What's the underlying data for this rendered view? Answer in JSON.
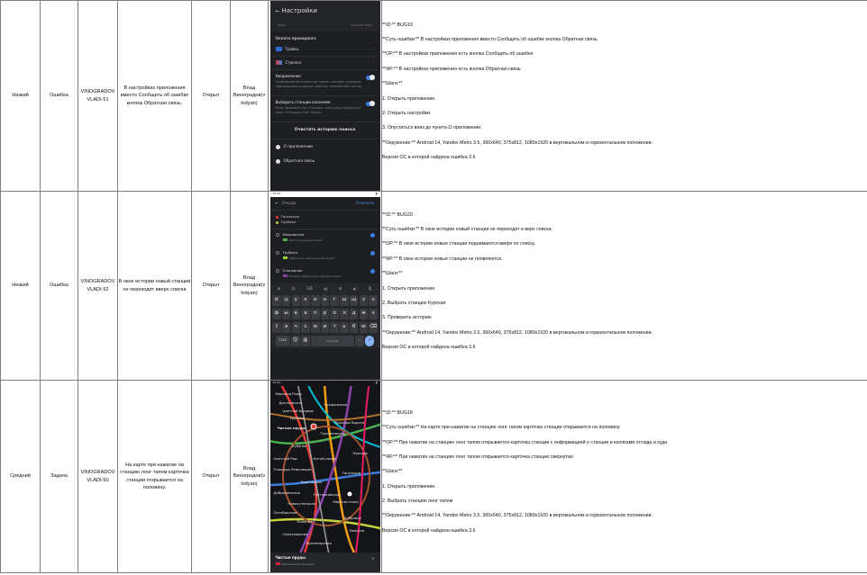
{
  "bugs": [
    {
      "priority": "Низкий",
      "type": "Ошибка",
      "key_line1": "VINOGRADOV",
      "key_line2": "VLADI-51",
      "summary": "В настройках приложения вместо Сообщить об ошибке кнопка Обратная связь.",
      "status": "Открыт",
      "assignee": "Влад Виноградов(v lodyan)",
      "description": [
        "**ID:** BUG19",
        "**Суть ошибки:** В настройках приложения вместо Сообщить об ошибке кнопка Обратная связь.",
        "**ОР:** В настройках приложения есть кнопка Сообщить об ошибке",
        "**ФР:** В настройках приложения есть кнопка Обратная связь",
        "**Шаги:**",
        "1. Открыть приложение.",
        "2. Открыть настройки",
        "3. Опуститься вниз до пункта О приложении",
        "**Окружение:** Android 14, Yandex Metro 3.6, 360x640, 375x812, 1080x1920 в вертикальном и горизонтальном положении.",
        "Версия ОС в которой найдена ошибка 3.6"
      ]
    },
    {
      "priority": "Низкий",
      "type": "Ошибка",
      "key_line1": "VINOGRADOV",
      "key_line2": "VLADI-52",
      "summary": "В окне истории новый станции не переходят вверх списка",
      "status": "Открыт",
      "assignee": "Влад Виноградов(v lodyan)",
      "description": [
        "**ID:** BUG20",
        "**Суть ошибки:** В окне истории новый станции не переходят в верх списка.",
        "**ОР:** В окне истории новые станции поднимаются вверх по списку.",
        "**ФР:** В окне истории новые станции не появляются.",
        "**Шаги:**",
        "1. Открыть приложение.",
        "2. Выбрать станцию Курская",
        "3. Проверить историю",
        "**Окружение:** Android 14, Yandex Metro 3.6, 360x640, 375x812, 1080x1920 в вертикальном и горизонтальном положении.",
        "Версия ОС в которой найдена ошибка 3.6"
      ]
    },
    {
      "priority": "Средний",
      "type": "Задача",
      "key_line1": "VINOGRADOV",
      "key_line2": "VLADI-50",
      "summary": "На карте при нажатие на станцию лонг тапом карточка станции открывается на половину.",
      "status": "Открыт",
      "assignee": "Влад Виноградов(v lodyan)",
      "description": [
        "**ID:** BUG18",
        "**Суть ошибки:** На карте при нажатие на станцию лонг тапом карточка станции открывается на половину.",
        "**ОР:** При нажатие на станцию лонг тапом открывается карточка станции с информацией о станции и кнопками отсюда и куда",
        "**ФР:** При нажатие на станцию лонг тапом открывается карточка станции свернутая",
        "**Шаги:**",
        "1. Открыть приложение.",
        "2. Выбрать станцию лонг тапом",
        "**Окружение:** Android 14, Yandex Metro 3.6, 360x640, 375x812, 1080x1920 в вертикальном и горизонтальном положении.",
        "Версия ОС в которой найдена ошибка 3.6"
      ]
    }
  ],
  "shot_settings": {
    "title": "Настройки",
    "header_left": "Язык",
    "header_right": "Русский язык",
    "pay_section": "Оплата проездного",
    "pay_items": [
      "Тройка",
      "Стрелка"
    ],
    "notif_title": "Уведомления",
    "notif_body": "Сообщения об открытии новых станций, крупных перекрытиях и других важных изменениях метро",
    "station_title": "Выбирать станции касанием",
    "station_body": "Если нажимать на станцию, она сразу появится в поле «Откуда» или «Куда»",
    "clear_btn": "Очистить историю поиска",
    "about": "О приложении",
    "feedback": "Обратная связь"
  },
  "shot_search": {
    "time": "15:03",
    "placeholder": "Откуда",
    "cancel": "Отменить",
    "history": [
      "Таганская",
      "Трубная"
    ],
    "stations": [
      {
        "name": "Маяковская",
        "line": "Замоскворецкая линия",
        "color": "#4caf50"
      },
      {
        "name": "Трубная",
        "line": "Люблинско-Дмитровская линия",
        "color": "#9acd32"
      },
      {
        "name": "Планерная",
        "line": "Таганско-Краснопресненская линия",
        "color": "#8e44ad"
      }
    ],
    "kb_tools": [
      "⊞",
      "☺",
      "GIF",
      "▤",
      "⚙",
      "◐",
      "🎙"
    ],
    "kb_row1": [
      "й",
      "ц",
      "у",
      "к",
      "е",
      "н",
      "г",
      "ш",
      "щ",
      "з",
      "х"
    ],
    "kb_row2": [
      "ф",
      "ы",
      "в",
      "а",
      "п",
      "р",
      "о",
      "л",
      "д",
      "ж",
      "э"
    ],
    "kb_row3": [
      "⇧",
      "я",
      "ч",
      "с",
      "м",
      "и",
      "т",
      "ь",
      "б",
      "ю",
      "⌫"
    ],
    "kb_num": "?123",
    "kb_space": "Русский",
    "kb_ok": "✓"
  },
  "shot_map": {
    "time": "15:03",
    "labels": [
      "Марьина Роща",
      "Достоевская",
      "Цветной бульвар",
      "Трубная",
      "Сухаревская",
      "Красные Ворота",
      "Чистые пруды",
      "Тургеневская",
      "Лубянка",
      "Курская",
      "Охотный Ряд",
      "Китай-город",
      "Площадь Революции",
      "Таганская",
      "Павелецкая",
      "Добрынинская",
      "Третьяковская",
      "Новокузнецкая",
      "Октябрьская",
      "Полянка",
      "Серпуховская",
      "Дубровка",
      "Марксистская",
      "Римская",
      "Пролетарская"
    ],
    "card_title": "Чистые пруды",
    "card_line": "Сокольническая линия"
  }
}
